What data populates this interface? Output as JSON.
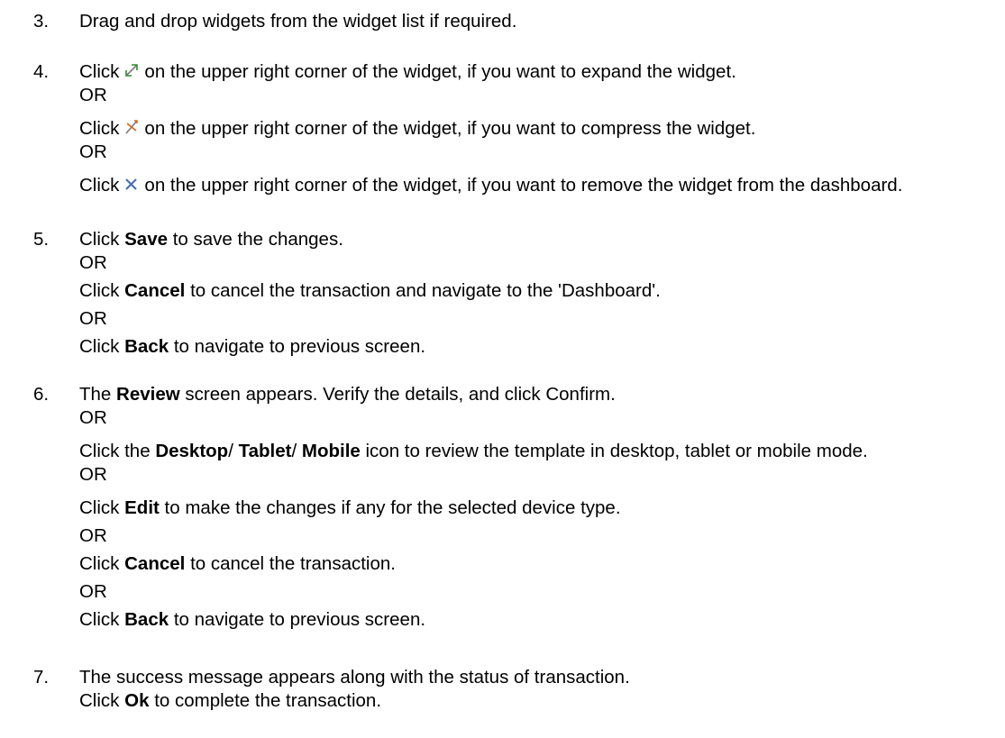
{
  "steps": [
    {
      "num": "3.",
      "lines": [
        {
          "t": "Drag and drop widgets from the widget list if required."
        }
      ]
    },
    {
      "num": "4.",
      "lines": [
        {
          "a": "Click",
          "icon": "expand-icon",
          "b": "on the upper right corner of the widget, if you want to expand the widget."
        },
        {
          "t": "OR"
        },
        {
          "a": "Click",
          "icon": "compress-icon",
          "b": "on the upper right corner of the widget, if you want to compress the widget."
        },
        {
          "t": "OR"
        },
        {
          "a": "Click",
          "icon": "close-icon",
          "b": "on the upper right corner of the widget, if you want to remove the widget from the dashboard."
        }
      ]
    },
    {
      "num": "5.",
      "lines": [
        {
          "a": "Click",
          "bold": "Save",
          "b": "to save the changes."
        },
        {
          "t": "OR"
        },
        {
          "a": "Click",
          "bold": "Cancel",
          "b": "to cancel the transaction and navigate to the 'Dashboard'."
        },
        {
          "t": "OR"
        },
        {
          "a": "Click",
          "bold": "Back",
          "b": "to navigate to previous screen."
        }
      ]
    },
    {
      "num": "6.",
      "lines": [
        {
          "a": "The",
          "bold": "Review",
          "b": "screen appears. Verify the details, and click Confirm."
        },
        {
          "t": "OR"
        },
        {
          "a": "Click the",
          "bold": "Desktop",
          "c": "/",
          "bold2": "Tablet",
          "c2": "/",
          "bold3": "Mobile",
          "b": "icon to review the template in desktop, tablet or mobile mode."
        },
        {
          "t": "OR"
        },
        {
          "a": "Click",
          "bold": "Edit",
          "b": "to make the changes if any for the selected device type."
        },
        {
          "t": "OR"
        },
        {
          "a": "Click",
          "bold": "Cancel",
          "b": "to cancel the transaction."
        },
        {
          "t": "OR"
        },
        {
          "a": "Click",
          "bold": "Back",
          "b": "to navigate to previous screen."
        }
      ]
    },
    {
      "num": "7.",
      "lines": [
        {
          "t": "The success message appears along with the status of transaction."
        },
        {
          "a": "Click",
          "bold": "Ok",
          "b": "to complete the transaction."
        }
      ]
    }
  ]
}
